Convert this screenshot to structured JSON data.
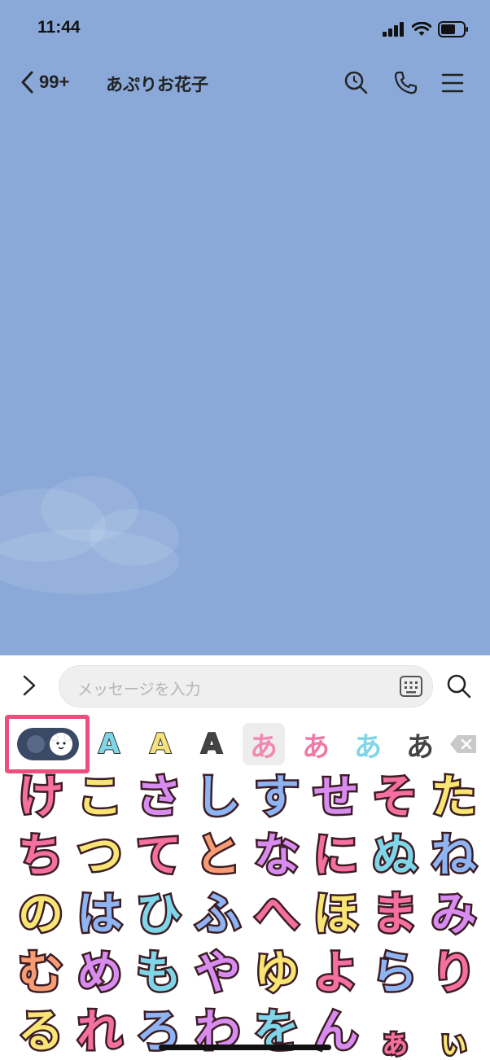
{
  "status_bar": {
    "time": "11:44"
  },
  "header": {
    "back_count": "99+",
    "title": "あぷりお花子"
  },
  "input": {
    "placeholder": "メッセージを入力"
  },
  "tabs": [
    {
      "glyph": "A",
      "color": "#7fd6e8",
      "style": "outline-blue"
    },
    {
      "glyph": "A",
      "color": "#f6e27a",
      "style": "outline-yellow"
    },
    {
      "glyph": "A",
      "color": "#444444",
      "style": "outline-dark"
    },
    {
      "glyph": "あ",
      "color": "#f18ab0",
      "style": "pink-bubble",
      "active": true
    },
    {
      "glyph": "あ",
      "color": "#f07aa5",
      "style": "pink"
    },
    {
      "glyph": "あ",
      "color": "#7fd6e8",
      "style": "blue"
    },
    {
      "glyph": "あ",
      "color": "#444444",
      "style": "dark"
    }
  ],
  "stickers": [
    {
      "char": "け",
      "color": "#f56fa0"
    },
    {
      "char": "こ",
      "color": "#f8e574"
    },
    {
      "char": "さ",
      "color": "#d88cf0"
    },
    {
      "char": "し",
      "color": "#8fb4f4"
    },
    {
      "char": "す",
      "color": "#8fb4f4"
    },
    {
      "char": "せ",
      "color": "#d88cf0"
    },
    {
      "char": "そ",
      "color": "#f56fa0"
    },
    {
      "char": "た",
      "color": "#f8e574"
    },
    {
      "char": "ち",
      "color": "#f56fa0"
    },
    {
      "char": "つ",
      "color": "#f8e574"
    },
    {
      "char": "て",
      "color": "#f56fa0"
    },
    {
      "char": "と",
      "color": "#f89c74"
    },
    {
      "char": "な",
      "color": "#d88cf0"
    },
    {
      "char": "に",
      "color": "#f56fa0"
    },
    {
      "char": "ぬ",
      "color": "#7fd6e8"
    },
    {
      "char": "ね",
      "color": "#8fb4f4"
    },
    {
      "char": "の",
      "color": "#f8e574"
    },
    {
      "char": "は",
      "color": "#8fb4f4"
    },
    {
      "char": "ひ",
      "color": "#7fd6e8"
    },
    {
      "char": "ふ",
      "color": "#8fb4f4"
    },
    {
      "char": "へ",
      "color": "#f56fa0"
    },
    {
      "char": "ほ",
      "color": "#f8e574"
    },
    {
      "char": "ま",
      "color": "#f56fa0"
    },
    {
      "char": "み",
      "color": "#d88cf0"
    },
    {
      "char": "む",
      "color": "#f89c74"
    },
    {
      "char": "め",
      "color": "#d88cf0"
    },
    {
      "char": "も",
      "color": "#7fd6e8"
    },
    {
      "char": "や",
      "color": "#d88cf0"
    },
    {
      "char": "ゆ",
      "color": "#f8e574"
    },
    {
      "char": "よ",
      "color": "#f56fa0"
    },
    {
      "char": "ら",
      "color": "#8fb4f4"
    },
    {
      "char": "り",
      "color": "#f56fa0"
    },
    {
      "char": "る",
      "color": "#f8e574"
    },
    {
      "char": "れ",
      "color": "#f56fa0"
    },
    {
      "char": "ろ",
      "color": "#8fb4f4"
    },
    {
      "char": "わ",
      "color": "#d88cf0"
    },
    {
      "char": "を",
      "color": "#7fd6e8"
    },
    {
      "char": "ん",
      "color": "#d88cf0"
    },
    {
      "char": "ぁ",
      "color": "#f56fa0"
    },
    {
      "char": "ぃ",
      "color": "#f8e574"
    }
  ],
  "colors": {
    "chat_bg": "#8aa9d8",
    "highlight": "#ec4e7d",
    "outline": "#3c1d24"
  }
}
